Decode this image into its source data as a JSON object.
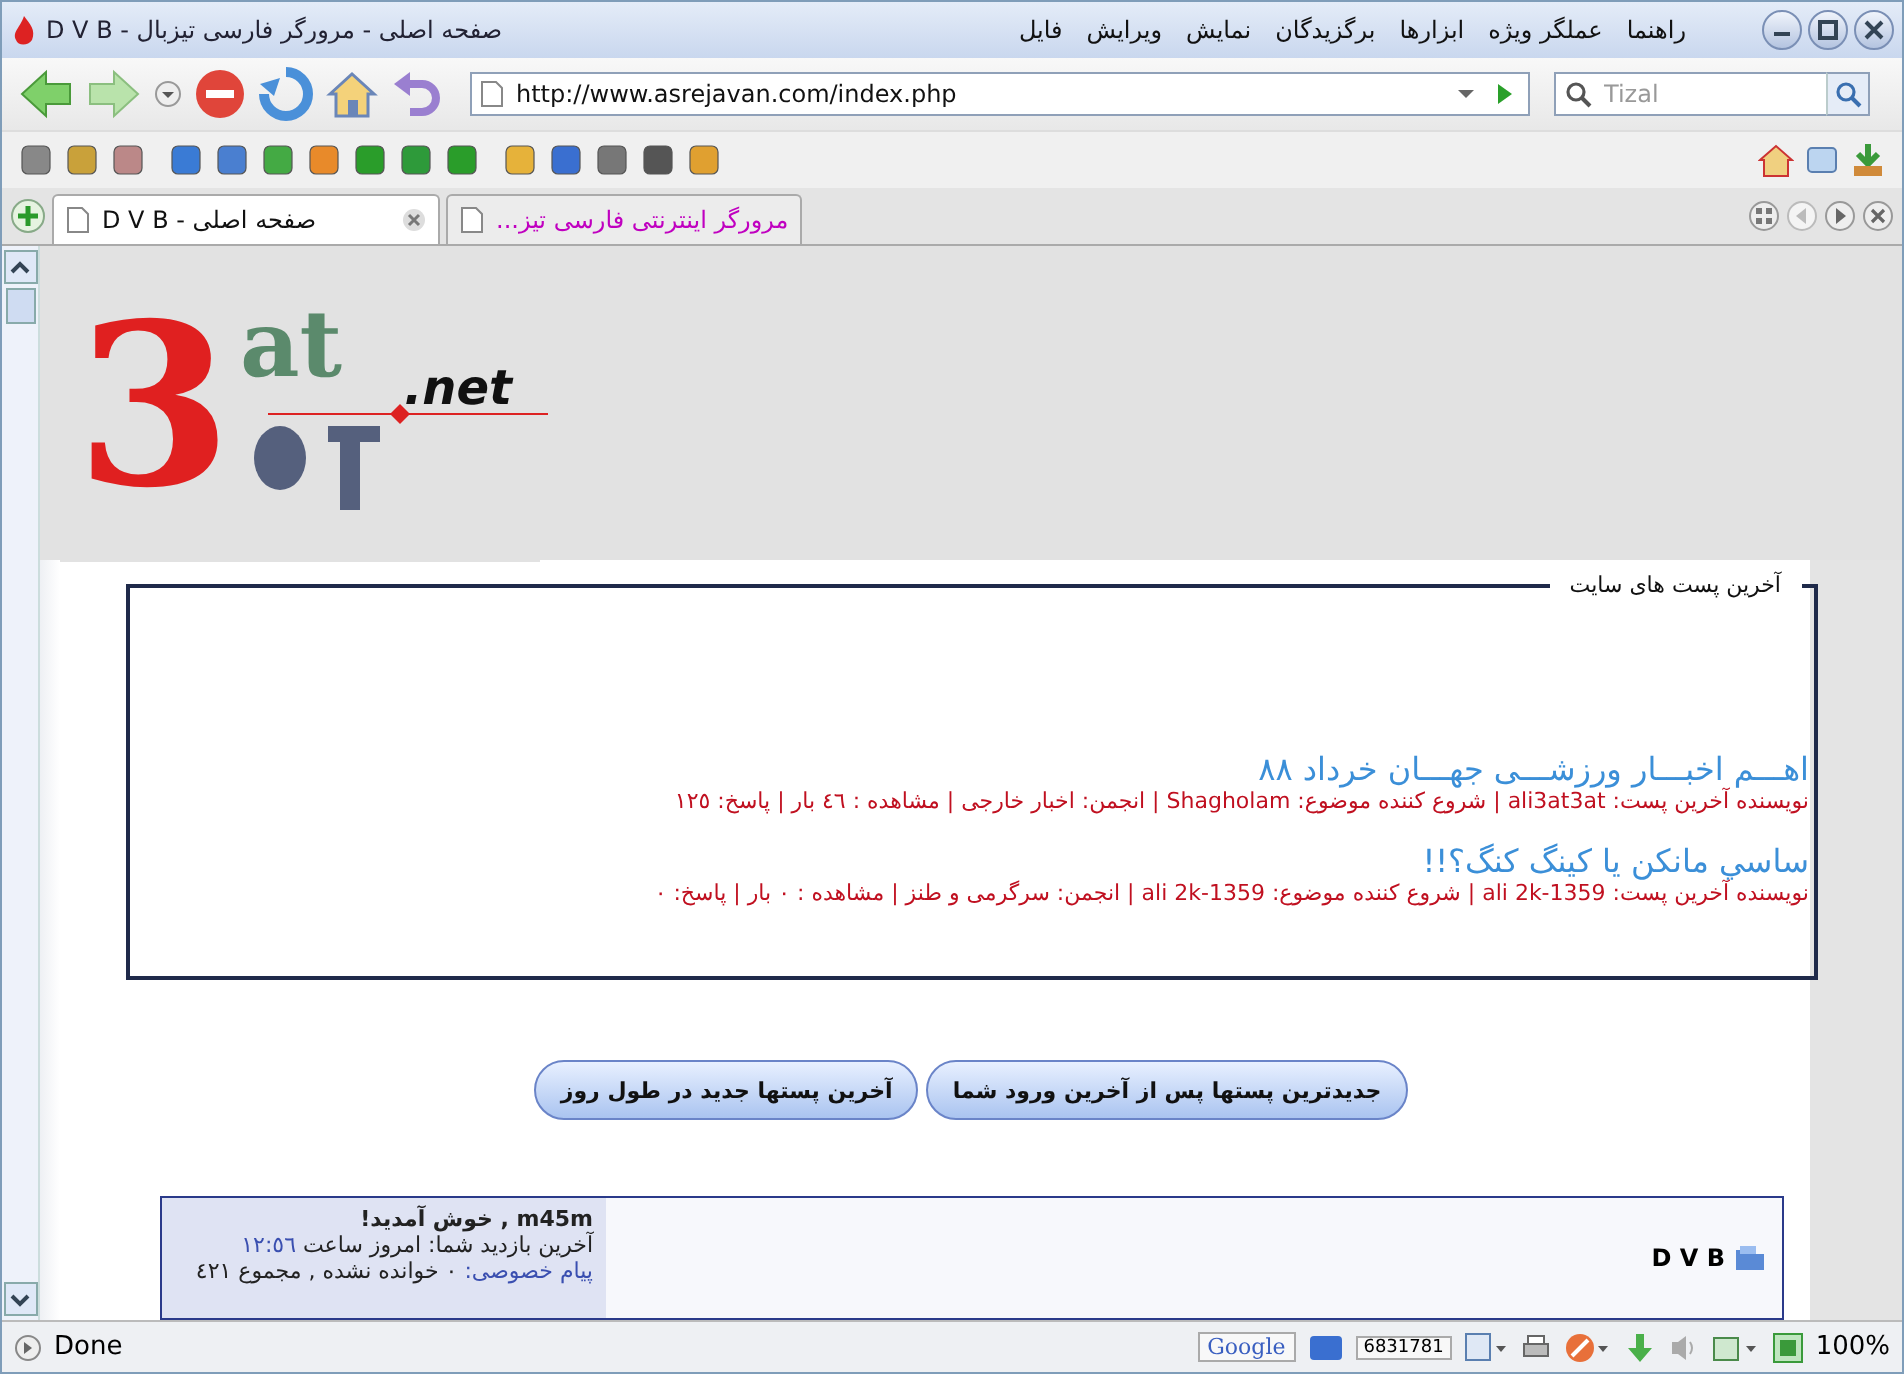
{
  "window": {
    "title": "صفحه اصلی - مرورگر فارسی تیزبال - D V B",
    "menu": [
      "راهنما",
      "عملگر ویژه",
      "ابزارها",
      "برگزیدگان",
      "نمایش",
      "ویرایش",
      "فایل"
    ]
  },
  "navbar": {
    "url": "http://www.asrejavan.com/index.php",
    "search_placeholder": "Tizal"
  },
  "tabs": [
    {
      "label": "مرورگر اینترنتی فارسی تیز...",
      "selected": false
    },
    {
      "label": "صفحه اصلی - D V B",
      "selected": true
    }
  ],
  "logo": {
    "digit": "3",
    "top": "at",
    "suffix": ".net"
  },
  "posts_box": {
    "legend": "آخرین پست های سایت",
    "posts": [
      {
        "title": "اهـــم اخبـــار ورزشـــی جهـــان خرداد ۸۸",
        "meta": "نویسنده آخرین پست: ali3at3at | شروع کننده موضوع: Shagholam | انجمن: اخبار خارجی | مشاهده : ٤٦ بار | پاسخ: ١٢٥"
      },
      {
        "title": "ساسي مانكن يا كينگ كنگ؟!!",
        "meta": "نویسنده آخرین پست: ali 2k-1359 | شروع کننده موضوع: ali 2k-1359 | انجمن: سرگرمی و طنز | مشاهده : ٠ بار | پاسخ: ٠"
      }
    ]
  },
  "buttons": [
    "جدیدترین پستها پس از آخرین ورود شما",
    "آخرین پستها جدید در طول روز"
  ],
  "welcome": {
    "greeting": "m45m , خوش آمدید!",
    "last_visit_label": "آخرین بازدید شما: امروز ساعت",
    "last_visit_time": "١٢:٥٦",
    "pm_label": "پیام خصوصی:",
    "pm_text": "٠ خوانده نشده , مجموع ٤٢١",
    "forum_title": "D V B"
  },
  "status_bar": {
    "text": "Done",
    "google": "Google",
    "counter": "6831781",
    "zoom": "100%"
  }
}
